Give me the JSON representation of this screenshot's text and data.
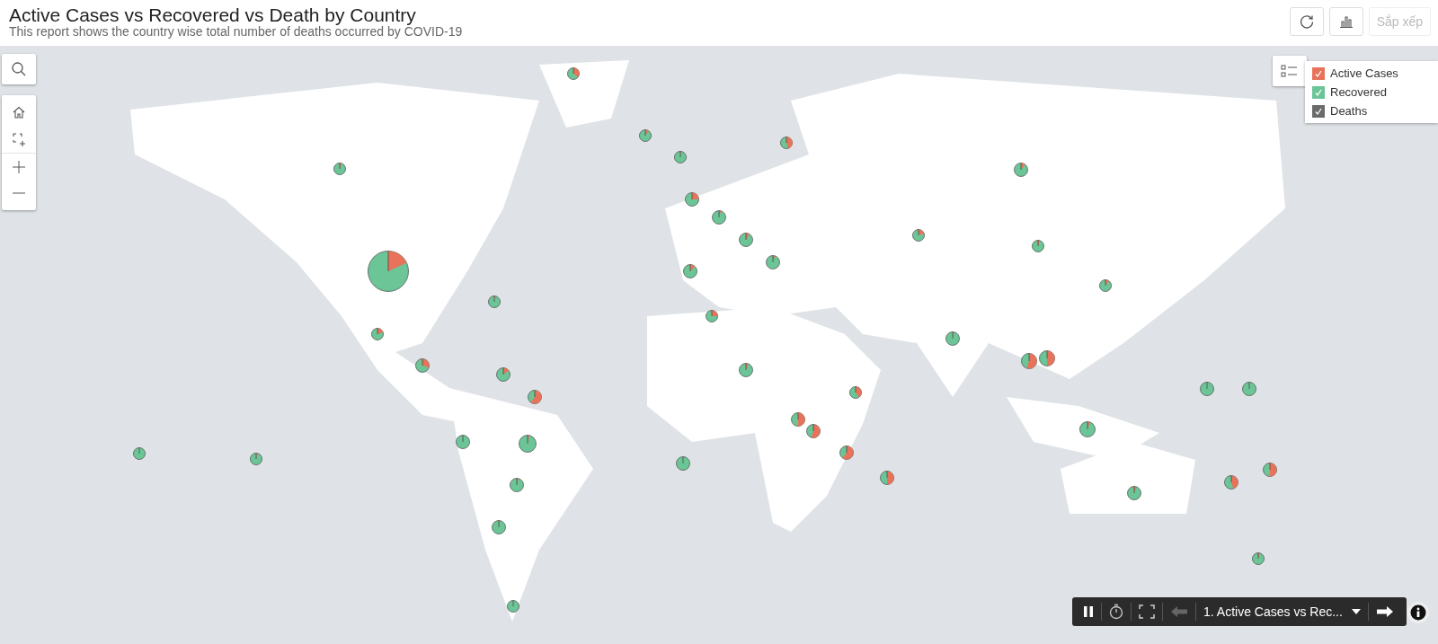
{
  "header": {
    "title": "Active Cases vs Recovered vs Death by Country",
    "subtitle": "This report shows the country wise total number of deaths occurred by COVID-19"
  },
  "toolbar": {
    "sort_button": {
      "label": "Sắp xếp",
      "disabled": true
    }
  },
  "legend": {
    "items": [
      {
        "label": "Active Cases",
        "color": "#e8735a",
        "checked": true
      },
      {
        "label": "Recovered",
        "color": "#6cc596",
        "checked": true
      },
      {
        "label": "Deaths",
        "color": "#6b6b6b",
        "checked": true
      }
    ]
  },
  "player": {
    "back_disabled": true,
    "slide": "1. Active Cases vs Rec..."
  }
}
